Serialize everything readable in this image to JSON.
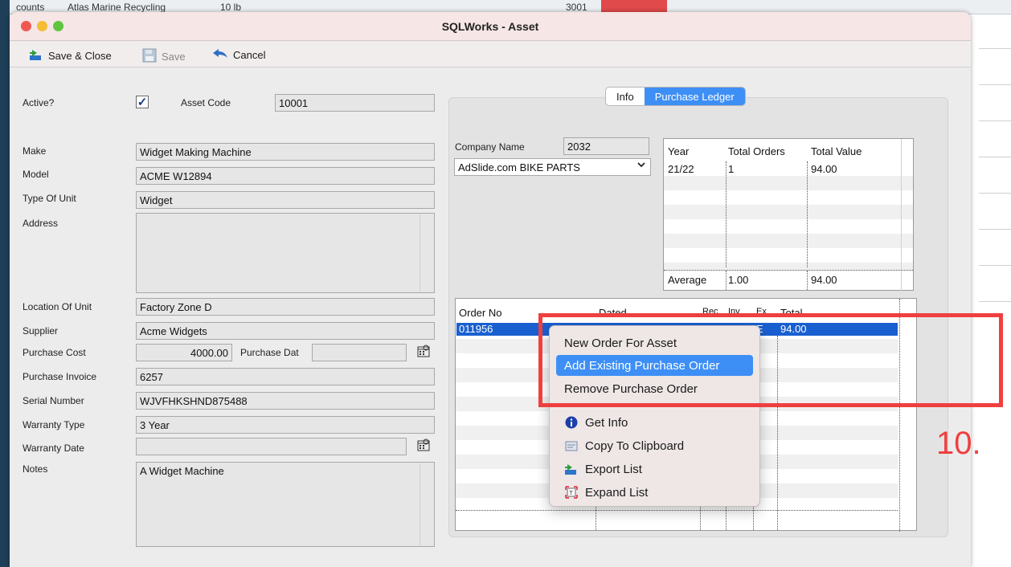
{
  "background": {
    "top_text_1": "counts",
    "top_text_2": "Atlas Marine Recycling",
    "top_text_3": "10 lb",
    "top_text_4": "3001"
  },
  "window": {
    "title": "SQLWorks - Asset"
  },
  "toolbar": {
    "save_close_label": "Save & Close",
    "save_label": "Save",
    "cancel_label": "Cancel"
  },
  "form": {
    "active_label": "Active?",
    "active_checked": true,
    "active_mark": "✓",
    "asset_code_label": "Asset Code",
    "asset_code_value": "10001",
    "make_label": "Make",
    "make_value": "Widget Making Machine",
    "model_label": "Model",
    "model_value": "ACME W12894",
    "type_label": "Type Of Unit",
    "type_value": "Widget",
    "address_label": "Address",
    "address_value": "",
    "location_label": "Location Of Unit",
    "location_value": "Factory Zone D",
    "supplier_label": "Supplier",
    "supplier_value": "Acme Widgets",
    "purchase_cost_label": "Purchase Cost",
    "purchase_cost_value": "4000.00",
    "purchase_date_label": "Purchase Dat",
    "purchase_date_value": "",
    "purchase_invoice_label": "Purchase Invoice",
    "purchase_invoice_value": "6257",
    "serial_label": "Serial Number",
    "serial_value": "WJVFHKSHND875488",
    "warranty_type_label": "Warranty Type",
    "warranty_type_value": "3 Year",
    "warranty_date_label": "Warranty Date",
    "warranty_date_value": "",
    "notes_label": "Notes",
    "notes_value": "A Widget Machine"
  },
  "tabs": {
    "info": "Info",
    "purchase_ledger": "Purchase Ledger",
    "active": "purchase_ledger"
  },
  "ledger": {
    "company_name_label": "Company Name",
    "company_code": "2032",
    "company_select_value": "AdSlide.com BIKE PARTS",
    "summary_headers": [
      "Year",
      "Total Orders",
      "Total Value"
    ],
    "summary_rows": [
      [
        "21/22",
        "1",
        "94.00"
      ]
    ],
    "average_label": "Average",
    "average_orders": "1.00",
    "average_value": "94.00",
    "orders_headers": [
      "Order No",
      "Dated",
      "Rec",
      "Inv",
      "Ex",
      "Total"
    ],
    "orders_rows": [
      [
        "011956",
        "",
        "",
        "",
        "E",
        "94.00"
      ]
    ]
  },
  "context_menu": {
    "items": [
      {
        "label": "New Order For Asset",
        "icon": "",
        "highlighted": false
      },
      {
        "label": "Add Existing Purchase Order",
        "icon": "",
        "highlighted": true
      },
      {
        "label": "Remove Purchase Order",
        "icon": "",
        "highlighted": false
      },
      {
        "label": "Get Info",
        "icon": "info-icon",
        "highlighted": false
      },
      {
        "label": "Copy To Clipboard",
        "icon": "clipboard-icon",
        "highlighted": false
      },
      {
        "label": "Export List",
        "icon": "export-icon",
        "highlighted": false
      },
      {
        "label": "Expand List",
        "icon": "expand-icon",
        "highlighted": false
      }
    ]
  },
  "annotation": {
    "step_label": "10.",
    "color": "#ef3f3f"
  },
  "colors": {
    "accent": "#3d8ff5",
    "selection": "#1a5fd0"
  }
}
